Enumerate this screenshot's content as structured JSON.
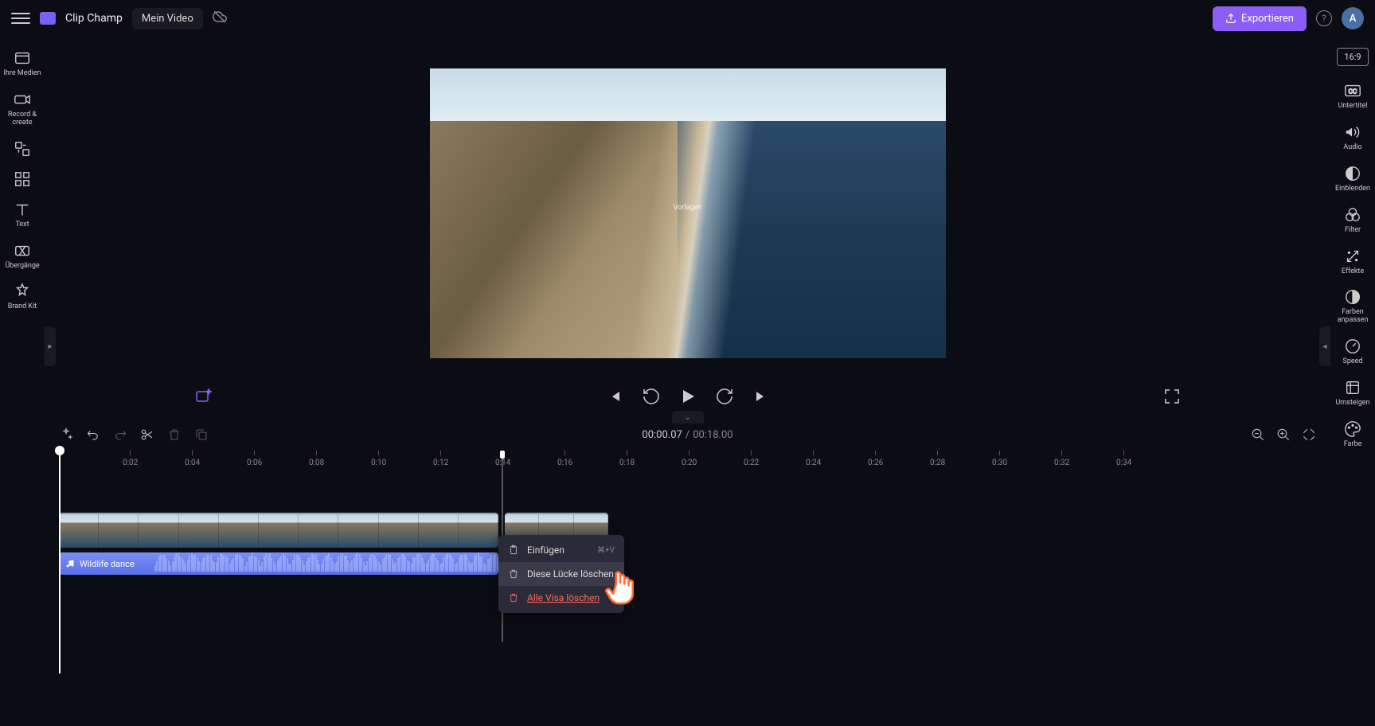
{
  "header": {
    "app_name": "Clip Champ",
    "project_name": "Mein Video",
    "export_label": "Exportieren",
    "avatar_initial": "A"
  },
  "left_rail": {
    "items": [
      {
        "label": "Ihre Medien",
        "icon": "media"
      },
      {
        "label": "Record &amp; create",
        "icon": "camera"
      },
      {
        "label": "",
        "icon": "swap"
      },
      {
        "label": "",
        "icon": "grid"
      },
      {
        "label": "Text",
        "icon": "text"
      },
      {
        "label": "Übergänge",
        "icon": "transitions"
      },
      {
        "label": "Brand Kit",
        "icon": "brand"
      }
    ]
  },
  "right_rail": {
    "aspect": "16:9",
    "items": [
      {
        "label": "Untertitel",
        "icon": "cc"
      },
      {
        "label": "Audio",
        "icon": "speaker"
      },
      {
        "label": "Einblenden",
        "icon": "fade"
      },
      {
        "label": "Filter",
        "icon": "filter"
      },
      {
        "label": "Effekte",
        "icon": "effects"
      },
      {
        "label": "Farben anpassen",
        "icon": "contrast"
      },
      {
        "label": "Speed",
        "icon": "speed"
      },
      {
        "label": "Umsteigen",
        "icon": "transform"
      },
      {
        "label": "Farbe",
        "icon": "palette"
      }
    ]
  },
  "preview": {
    "overlay_text": "Vorlagen"
  },
  "timeline": {
    "current": "00:00.07",
    "sep": "/",
    "duration": "00:18.00",
    "ticks": [
      "0:02",
      "0:04",
      "0:06",
      "0:08",
      "0:10",
      "0:12",
      "0:14",
      "0:16",
      "0:18",
      "0:20",
      "0:22",
      "0:24",
      "0:26",
      "0:28",
      "0:30",
      "0:32",
      "0:34"
    ],
    "audio_clip_name": "Wildlife dance"
  },
  "ctx": {
    "paste": "Einfügen",
    "paste_shortcut": "⌘+V",
    "delete_gap": "Diese Lücke löschen",
    "delete_all": "Alle Visa löschen"
  }
}
